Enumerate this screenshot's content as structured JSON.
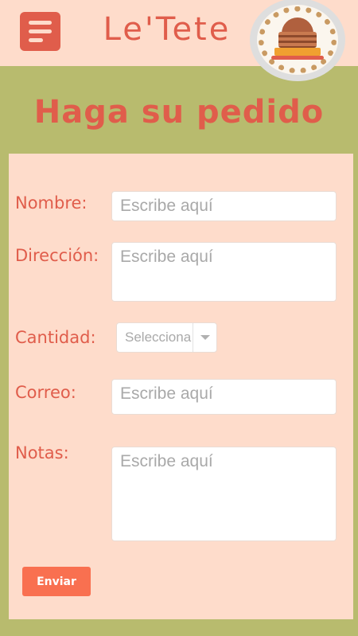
{
  "header": {
    "brand": "Le'Tete",
    "menu_icon": "hamburger-menu-icon",
    "logo_icon": "cake-logo-icon"
  },
  "page": {
    "title": "Haga su pedido"
  },
  "form": {
    "name": {
      "label": "Nombre:",
      "placeholder": "Escribe aquí"
    },
    "address": {
      "label": "Dirección:",
      "placeholder": "Escribe aquí"
    },
    "quantity": {
      "label": "Cantidad:",
      "selected": "Selecciona"
    },
    "email": {
      "label": "Correo:",
      "placeholder": "Escribe aquí"
    },
    "notes": {
      "label": "Notas:",
      "placeholder": "Escribe aquí"
    },
    "submit_label": "Enviar"
  },
  "colors": {
    "accent": "#e05d4b",
    "background": "#b8bb6e",
    "panel": "#fedccb",
    "button": "#f97050"
  }
}
